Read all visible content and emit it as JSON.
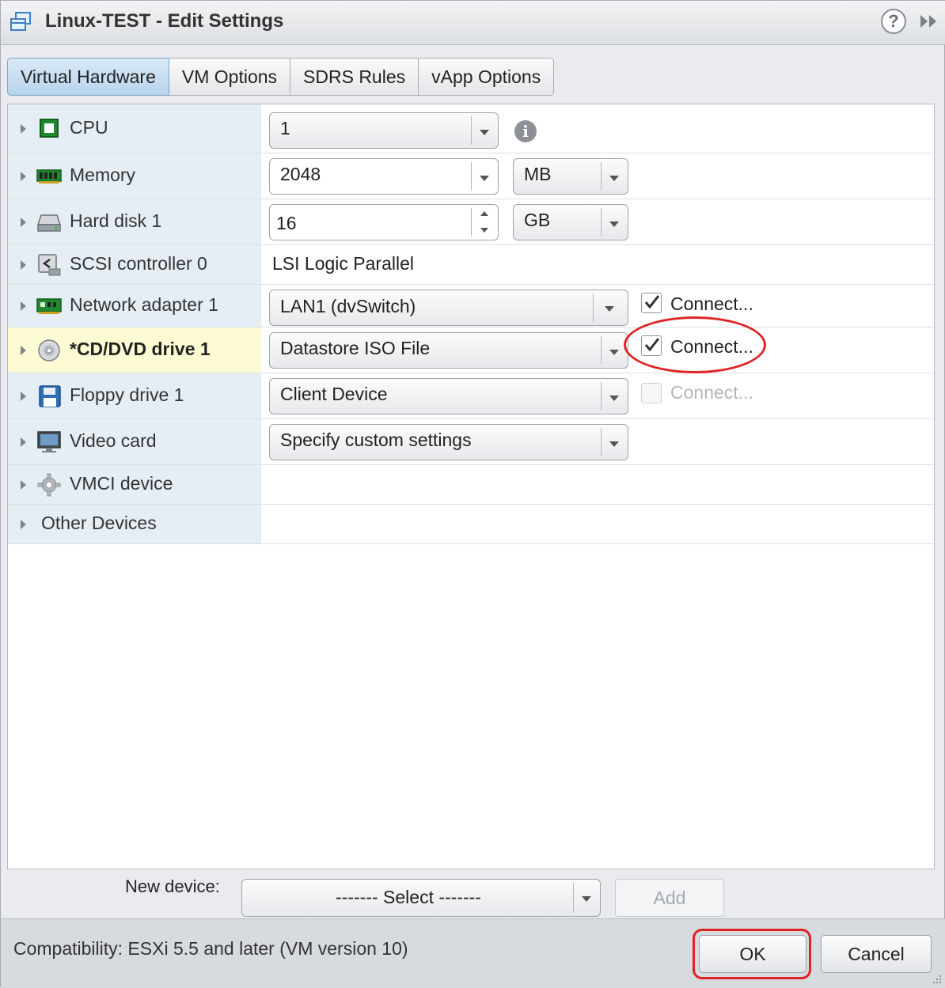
{
  "window": {
    "title": "Linux-TEST - Edit Settings"
  },
  "tabs": [
    {
      "label": "Virtual Hardware",
      "active": true
    },
    {
      "label": "VM Options",
      "active": false
    },
    {
      "label": "SDRS Rules",
      "active": false
    },
    {
      "label": "vApp Options",
      "active": false
    }
  ],
  "devices": {
    "cpu": {
      "name": "CPU",
      "icon": "cpu-icon",
      "value": "1"
    },
    "memory": {
      "name": "Memory",
      "icon": "memory-icon",
      "value": "2048",
      "unit": "MB"
    },
    "hard_disk": {
      "name": "Hard disk 1",
      "icon": "hard-disk-icon",
      "value": "16",
      "unit": "GB"
    },
    "scsi": {
      "name": "SCSI controller 0",
      "icon": "scsi-controller-icon",
      "value": "LSI Logic Parallel"
    },
    "network": {
      "name": "Network adapter 1",
      "icon": "network-adapter-icon",
      "value": "LAN1 (dvSwitch)",
      "connect_label": "Connect...",
      "connected": true
    },
    "cdrom": {
      "name": "*CD/DVD drive 1",
      "icon": "cd-dvd-icon",
      "value": "Datastore ISO File",
      "connect_label": "Connect...",
      "connected": true,
      "highlighted": true
    },
    "floppy": {
      "name": "Floppy drive 1",
      "icon": "floppy-icon",
      "value": "Client Device",
      "connect_label": "Connect...",
      "connected": false,
      "disabled": true
    },
    "video": {
      "name": "Video card",
      "icon": "video-card-icon",
      "value": "Specify custom settings"
    },
    "vmci": {
      "name": "VMCI device",
      "icon": "gear-icon"
    },
    "other": {
      "name": "Other Devices"
    }
  },
  "new_device": {
    "label": "New device:",
    "select_value": "------- Select -------",
    "add_label": "Add"
  },
  "footer": {
    "compatibility": "Compatibility: ESXi 5.5 and later (VM version 10)",
    "ok_label": "OK",
    "cancel_label": "Cancel"
  },
  "colors": {
    "annotation": "#e02424",
    "selected_row": "#fdfbd3",
    "label_column": "#e6eef5",
    "active_tab": "#b8d4ec"
  }
}
